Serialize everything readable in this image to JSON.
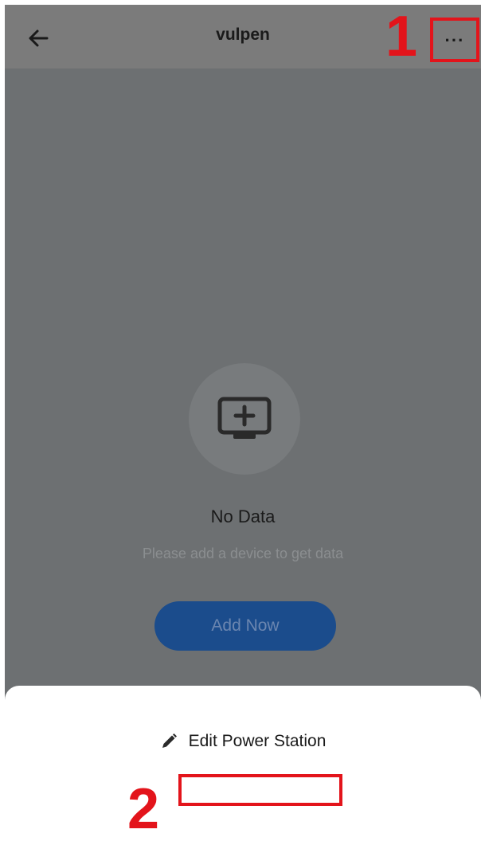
{
  "header": {
    "title": "vulpen",
    "back_icon": "arrow-left-icon",
    "more_label": "···"
  },
  "annotations": {
    "step1": "1",
    "step2": "2",
    "color": "#e3141b"
  },
  "empty_state": {
    "icon": "monitor-plus-icon",
    "title": "No Data",
    "hint": "Please add a device to get data",
    "button_label": "Add Now"
  },
  "bottom_sheet": {
    "items": [
      {
        "label": "Edit Power Station",
        "icon": "pencil-icon"
      }
    ]
  },
  "colors": {
    "accent": "#1b4c8c",
    "overlay": "#6d7072",
    "annotation": "#e3141b"
  }
}
